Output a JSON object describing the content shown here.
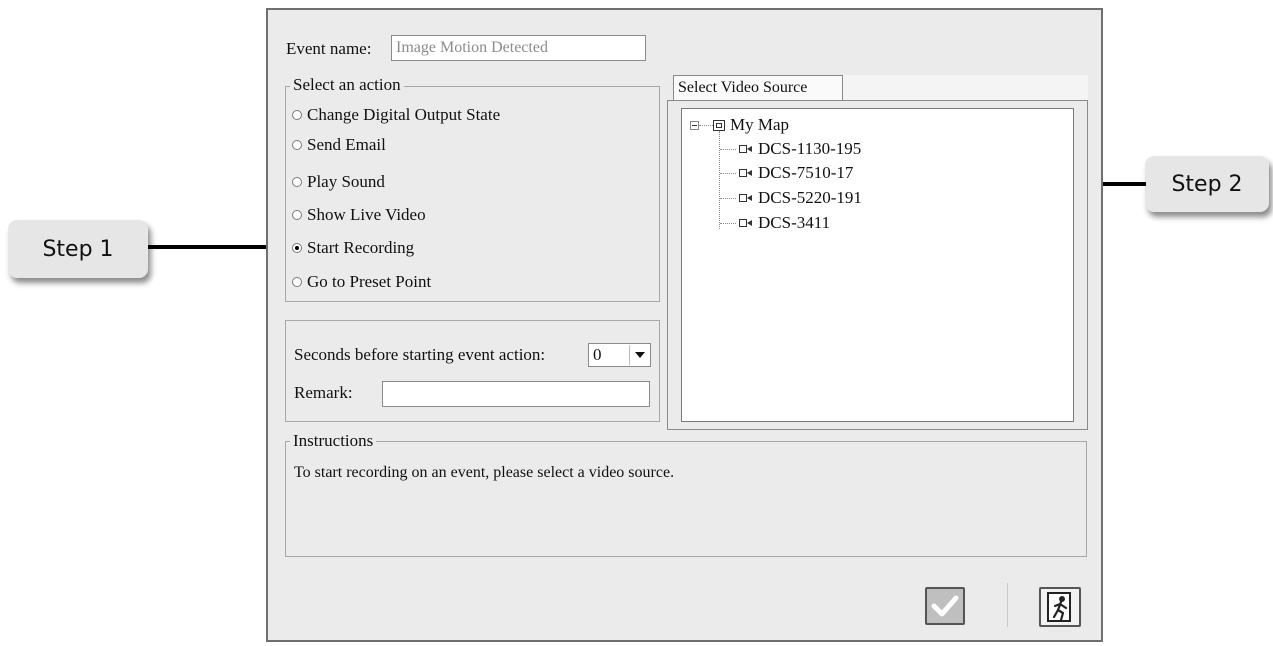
{
  "event": {
    "name_label": "Event name:",
    "name_value": "Image Motion Detected"
  },
  "action_group": {
    "legend": "Select an action",
    "options": [
      {
        "label": "Change Digital Output State",
        "checked": false
      },
      {
        "label": "Send Email",
        "checked": false
      },
      {
        "label": "Play Sound",
        "checked": false
      },
      {
        "label": "Show Live Video",
        "checked": false
      },
      {
        "label": "Start Recording",
        "checked": true
      },
      {
        "label": "Go to Preset Point",
        "checked": false
      }
    ]
  },
  "delay": {
    "label": "Seconds before starting event action:",
    "value": "0"
  },
  "remark": {
    "label": "Remark:",
    "value": ""
  },
  "video_source": {
    "tab_label": "Select Video Source",
    "root": "My Map",
    "cameras": [
      "DCS-1130-195",
      "DCS-7510-17",
      "DCS-5220-191",
      "DCS-3411"
    ]
  },
  "instructions": {
    "legend": "Instructions",
    "text": "To start recording on an event, please select a video source."
  },
  "callouts": {
    "step1": "Step 1",
    "step2": "Step 2"
  },
  "icons": {
    "ok": "checkmark-icon",
    "exit": "exit-door-icon",
    "camera": "camera-icon",
    "map": "map-icon"
  }
}
